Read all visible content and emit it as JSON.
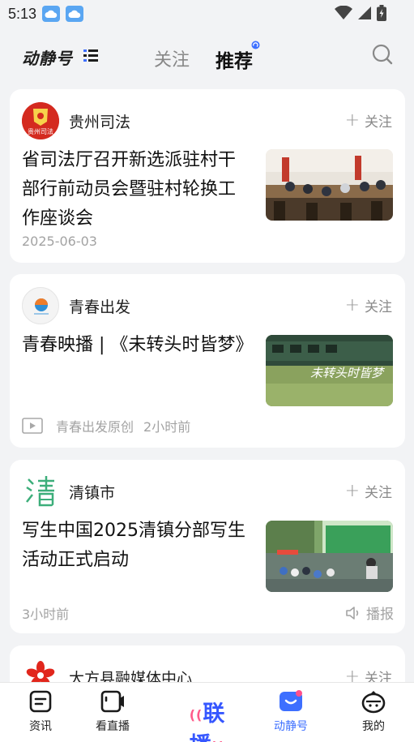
{
  "status_bar": {
    "time": "5:13"
  },
  "header": {
    "logo": "动静号",
    "tabs": [
      {
        "label": "关注",
        "active": false
      },
      {
        "label": "推荐",
        "active": true
      }
    ]
  },
  "feed": [
    {
      "source": "贵州司法",
      "follow_label": "关注",
      "title": "省司法厅召开新选派驻村干部行前动员会暨驻村轮换工作座谈会",
      "meta_date": "2025-06-03",
      "avatar_text": "贵州司法"
    },
    {
      "source": "青春出发",
      "follow_label": "关注",
      "title": "青春映播 | 《未转头时皆梦》",
      "meta_channel": "青春出发原创",
      "meta_time": "2小时前",
      "thumb_caption": "未转头时皆梦"
    },
    {
      "source": "清镇市",
      "follow_label": "关注",
      "title": "写生中国2025清镇分部写生活动正式启动",
      "meta_time": "3小时前",
      "broadcast_label": "播报"
    },
    {
      "source": "大方县融媒体中心",
      "follow_label": "关注"
    }
  ],
  "bottom_nav": {
    "items": [
      {
        "label": "资讯",
        "icon": "news-icon"
      },
      {
        "label": "看直播",
        "icon": "live-icon"
      },
      {
        "label": "动静号",
        "icon": "dongjing-icon",
        "active": true
      },
      {
        "label": "我的",
        "icon": "profile-icon"
      }
    ],
    "center_label": "联播"
  },
  "colors": {
    "accent": "#3d6fff",
    "background": "#f2f3f5"
  }
}
